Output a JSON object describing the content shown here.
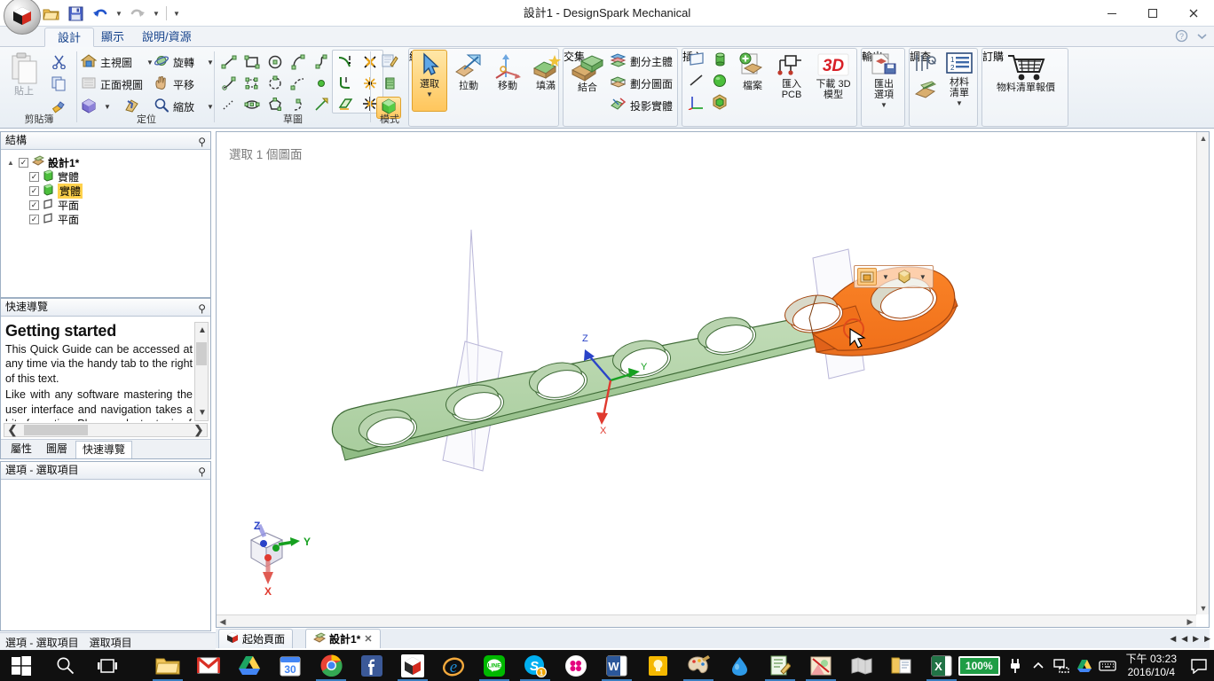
{
  "window": {
    "title": "設計1 - DesignSpark Mechanical",
    "minimize": "—",
    "maximize": "❐",
    "close": "✕"
  },
  "quick_access": {
    "open_icon": "open-folder-icon",
    "save_icon": "save-icon",
    "undo_icon": "undo-icon",
    "redo_icon": "redo-icon",
    "customize_icon": "customize-qat-icon"
  },
  "ribbon_tabs": [
    {
      "label": "設計",
      "active": true
    },
    {
      "label": "顯示",
      "active": false
    },
    {
      "label": "說明/資源",
      "active": false
    }
  ],
  "ribbon_corner": {
    "help_icon": "help-icon",
    "expand_icon": "minimize-ribbon-icon"
  },
  "ribbon_groups": [
    {
      "name": "clipboard",
      "label": "剪貼簿",
      "big": {
        "label": "貼上",
        "icon": "paste-icon",
        "disabled": true
      },
      "small": [
        {
          "label": "",
          "icon": "cut-icon"
        },
        {
          "label": "",
          "icon": "copy-icon"
        },
        {
          "label": "",
          "icon": "format-painter-icon"
        }
      ]
    },
    {
      "name": "orient",
      "label": "定位",
      "items": [
        {
          "label": "主視圖",
          "icon": "home-view-icon",
          "caret": true,
          "disabled": false
        },
        {
          "label": "旋轉",
          "icon": "spin-icon",
          "caret": true,
          "disabled": false
        },
        {
          "label": "正面視圖",
          "icon": "plan-view-icon",
          "caret": false,
          "disabled": true
        },
        {
          "label": "平移",
          "icon": "pan-hand-icon",
          "caret": false,
          "disabled": false
        },
        {
          "label": "",
          "icon": "view-cube-icon",
          "caret": true,
          "disabled": false
        },
        {
          "label": "",
          "icon": "previous-view-icon",
          "caret": false,
          "disabled": false
        },
        {
          "label": "縮放",
          "icon": "zoom-icon",
          "caret": true,
          "disabled": false
        }
      ]
    },
    {
      "name": "sketch",
      "label": "草圖",
      "tools": [
        "line-icon",
        "rectangle-icon",
        "circle-icon",
        "tangent-arc-icon",
        "spline-icon",
        "tangent-line-icon",
        "polygon-icon",
        "three-point-arc-icon",
        "dashed-arc-icon",
        "point-icon",
        "dotted-line-icon",
        "ellipse-icon",
        "polygon-shape-icon",
        "sweep-arc-icon",
        "construction-line-icon"
      ],
      "edit_tools": [
        "trim-icon",
        "split-icon",
        "corner-icon",
        "offset-scatter-icon",
        "project-icon",
        "cleanup-icon"
      ]
    },
    {
      "name": "mode",
      "label": "模式",
      "items": [
        {
          "icon": "sketch-mode-icon",
          "active": false
        },
        {
          "icon": "section-mode-icon",
          "active": false
        },
        {
          "icon": "solid-mode-icon",
          "active": true
        }
      ]
    },
    {
      "name": "edit",
      "label": "編輯",
      "items": [
        {
          "label": "選取",
          "icon": "select-cursor-icon",
          "caret": true,
          "active": true
        },
        {
          "label": "拉動",
          "icon": "pull-icon",
          "caret": false,
          "active": false
        },
        {
          "label": "移動",
          "icon": "move-icon",
          "caret": false,
          "active": false
        },
        {
          "label": "填滿",
          "icon": "fill-icon",
          "caret": false,
          "active": false
        }
      ]
    },
    {
      "name": "intersect",
      "label": "交集",
      "big": {
        "label": "結合",
        "icon": "combine-icon"
      },
      "small": [
        {
          "label": "劃分主體",
          "icon": "split-body-icon"
        },
        {
          "label": "劃分圖面",
          "icon": "split-face-icon"
        },
        {
          "label": "投影實體",
          "icon": "project-solid-icon"
        }
      ]
    },
    {
      "name": "insert",
      "label": "插入",
      "primitives": [
        "plane-icon",
        "cylinder-icon",
        "line-3d-icon",
        "sphere-icon",
        "axis-icon",
        "solid-primitive-icon"
      ],
      "items": [
        {
          "label": "檔案",
          "icon": "insert-file-icon"
        },
        {
          "label": "匯入\nPCB",
          "icon": "import-pcb-icon"
        },
        {
          "label": "下載 3D\n模型",
          "icon": "download-3d-icon",
          "badge": "3D"
        }
      ]
    },
    {
      "name": "output",
      "label": "輸出",
      "items": [
        {
          "label": "匯出\n選項",
          "icon": "export-options-icon",
          "caret": true
        }
      ]
    },
    {
      "name": "survey",
      "label": "調查",
      "small": [
        {
          "icon": "measure-icon"
        },
        {
          "icon": "mass-properties-icon"
        }
      ],
      "items": [
        {
          "label": "材料\n清單",
          "icon": "bom-list-icon",
          "caret": true
        }
      ]
    },
    {
      "name": "order",
      "label": "訂購",
      "items": [
        {
          "label": "物料清單報價",
          "icon": "cart-icon"
        }
      ]
    }
  ],
  "structure_panel": {
    "title": "結構",
    "pin_icon": "pin-icon",
    "tree": [
      {
        "label": "設計1*",
        "indent": 0,
        "checked": true,
        "icon": "design-icon",
        "selected": false,
        "expander": "▲"
      },
      {
        "label": "實體",
        "indent": 1,
        "checked": true,
        "icon": "solid-icon",
        "selected": false
      },
      {
        "label": "實體",
        "indent": 1,
        "checked": true,
        "icon": "solid-icon",
        "selected": true
      },
      {
        "label": "平面",
        "indent": 1,
        "checked": true,
        "icon": "plane-icon",
        "selected": false
      },
      {
        "label": "平面",
        "indent": 1,
        "checked": true,
        "icon": "plane-icon",
        "selected": false
      }
    ]
  },
  "guide_panel": {
    "title": "快速導覽",
    "pin_icon": "pin-icon",
    "heading": "Getting started",
    "paragraphs": [
      "This Quick Guide can be accessed at any time via the handy tab to the right of this text.",
      "Like with any software mastering the user interface and navigation takes a bit of practice. Please select a topic of"
    ],
    "prev_label": "❮",
    "next_label": "❯",
    "tabs": [
      {
        "label": "屬性",
        "active": false
      },
      {
        "label": "圖層",
        "active": false
      },
      {
        "label": "快速導覽",
        "active": true
      }
    ]
  },
  "options_panel": {
    "title": "選項 - 選取項目",
    "pin_icon": "pin-icon"
  },
  "viewport": {
    "status": "選取 1 個圖面",
    "axis_labels": {
      "x": "X",
      "y": "Y",
      "z": "Z"
    },
    "model_axis_labels": {
      "x": "X",
      "y": "Y",
      "z": "Z"
    },
    "colors": {
      "body": "#b5d3ac",
      "selected": "#f5771e",
      "x_axis": "#e03a2f",
      "y_axis": "#16a020",
      "z_axis": "#2a43c8"
    },
    "mini_toolbar": [
      {
        "icon": "selection-face-icon",
        "active": true,
        "caret": true
      },
      {
        "icon": "selection-solid-icon",
        "active": false,
        "caret": true
      }
    ]
  },
  "document_tabs": [
    {
      "label": "起始頁面",
      "icon": "home-page-icon",
      "active": false,
      "closable": false
    },
    {
      "label": "設計1*",
      "icon": "design-doc-icon",
      "active": true,
      "closable": true,
      "close": "✕"
    }
  ],
  "status_bar": {
    "cells": [
      "選項 - 選取項目",
      "選取項目"
    ],
    "nav": [
      "◀",
      "◀",
      "▶",
      "▶"
    ]
  },
  "taskbar": {
    "start_icon": "windows-start-icon",
    "search_icon": "search-icon",
    "taskview_icon": "task-view-icon",
    "items": [
      {
        "icon": "file-explorer-icon",
        "running": true
      },
      {
        "icon": "gmail-icon",
        "running": false
      },
      {
        "icon": "google-drive-icon",
        "running": false
      },
      {
        "icon": "calendar-icon",
        "label": "30",
        "running": false
      },
      {
        "icon": "chrome-icon",
        "running": true
      },
      {
        "icon": "facebook-icon",
        "running": false
      },
      {
        "icon": "designspark-icon",
        "running": true
      },
      {
        "icon": "internet-explorer-icon",
        "running": false
      },
      {
        "icon": "line-icon",
        "running": true
      },
      {
        "icon": "skype-icon",
        "badge": "1",
        "running": true
      },
      {
        "icon": "flickr-icon",
        "running": false
      },
      {
        "icon": "word-icon",
        "running": true
      },
      {
        "icon": "notes-icon",
        "running": false
      },
      {
        "icon": "paint-icon",
        "running": true
      },
      {
        "icon": "waterdrop-icon",
        "running": false
      },
      {
        "icon": "editor-icon",
        "running": true
      },
      {
        "icon": "photos-icon",
        "running": true
      },
      {
        "icon": "map-icon",
        "running": false
      },
      {
        "icon": "folder-doc-icon",
        "running": false
      },
      {
        "icon": "excel-icon",
        "running": true
      }
    ],
    "tray": {
      "battery_label": "100%",
      "battery_color": "#1f9d45",
      "icons": [
        "plug-icon",
        "show-hidden-icon",
        "network-icon",
        "google-drive-icon",
        "keyboard-icon"
      ],
      "time": "下午 03:23",
      "date": "2016/10/4",
      "notification_icon": "notification-icon"
    }
  }
}
